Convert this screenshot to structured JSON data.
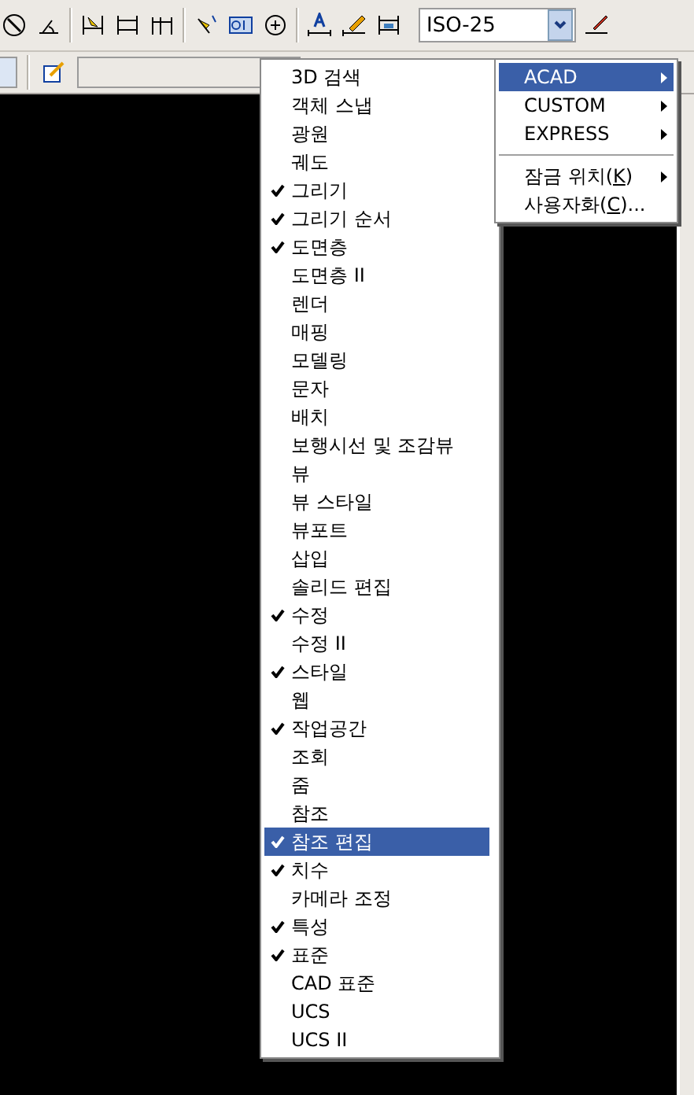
{
  "toolbar": {
    "dimension_style": "ISO-25"
  },
  "menu": {
    "items": [
      {
        "label": "3D 검색",
        "checked": false,
        "selected": false
      },
      {
        "label": "객체 스냅",
        "checked": false,
        "selected": false
      },
      {
        "label": "광원",
        "checked": false,
        "selected": false
      },
      {
        "label": "궤도",
        "checked": false,
        "selected": false
      },
      {
        "label": "그리기",
        "checked": true,
        "selected": false
      },
      {
        "label": "그리기 순서",
        "checked": true,
        "selected": false
      },
      {
        "label": "도면층",
        "checked": true,
        "selected": false
      },
      {
        "label": "도면층 II",
        "checked": false,
        "selected": false
      },
      {
        "label": "렌더",
        "checked": false,
        "selected": false
      },
      {
        "label": "매핑",
        "checked": false,
        "selected": false
      },
      {
        "label": "모델링",
        "checked": false,
        "selected": false
      },
      {
        "label": "문자",
        "checked": false,
        "selected": false
      },
      {
        "label": "배치",
        "checked": false,
        "selected": false
      },
      {
        "label": "보행시선 및 조감뷰",
        "checked": false,
        "selected": false
      },
      {
        "label": "뷰",
        "checked": false,
        "selected": false
      },
      {
        "label": "뷰 스타일",
        "checked": false,
        "selected": false
      },
      {
        "label": "뷰포트",
        "checked": false,
        "selected": false
      },
      {
        "label": "삽입",
        "checked": false,
        "selected": false
      },
      {
        "label": "솔리드 편집",
        "checked": false,
        "selected": false
      },
      {
        "label": "수정",
        "checked": true,
        "selected": false
      },
      {
        "label": "수정 II",
        "checked": false,
        "selected": false
      },
      {
        "label": "스타일",
        "checked": true,
        "selected": false
      },
      {
        "label": "웹",
        "checked": false,
        "selected": false
      },
      {
        "label": "작업공간",
        "checked": true,
        "selected": false
      },
      {
        "label": "조회",
        "checked": false,
        "selected": false
      },
      {
        "label": "줌",
        "checked": false,
        "selected": false
      },
      {
        "label": "참조",
        "checked": false,
        "selected": false
      },
      {
        "label": "참조 편집",
        "checked": true,
        "selected": true
      },
      {
        "label": "치수",
        "checked": true,
        "selected": false
      },
      {
        "label": "카메라 조정",
        "checked": false,
        "selected": false
      },
      {
        "label": "특성",
        "checked": true,
        "selected": false
      },
      {
        "label": "표준",
        "checked": true,
        "selected": false
      },
      {
        "label": "CAD 표준",
        "checked": false,
        "selected": false
      },
      {
        "label": "UCS",
        "checked": false,
        "selected": false
      },
      {
        "label": "UCS II",
        "checked": false,
        "selected": false
      }
    ]
  },
  "submenu": {
    "items": [
      {
        "kind": "submenu",
        "label": "ACAD",
        "selected": true
      },
      {
        "kind": "submenu",
        "label": "CUSTOM",
        "selected": false
      },
      {
        "kind": "submenu",
        "label": "EXPRESS",
        "selected": false
      },
      {
        "kind": "separator"
      },
      {
        "kind": "submenu",
        "label": "잠금 위치(",
        "mnemonic": "K",
        "label_end": ")",
        "selected": false
      },
      {
        "kind": "command",
        "label": "사용자화(",
        "mnemonic": "C",
        "label_end": ")...",
        "selected": false
      }
    ]
  }
}
